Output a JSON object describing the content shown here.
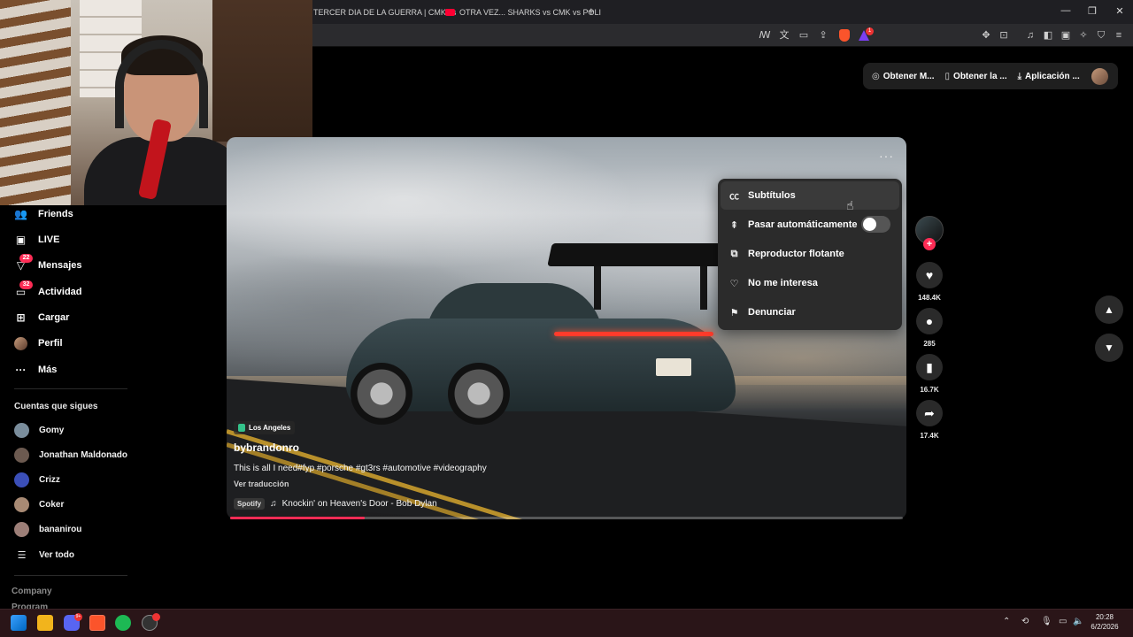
{
  "browser": {
    "tabs": [
      {
        "label": "TERCER DIA DE LA GUERRA | CMK vs"
      },
      {
        "label": "OTRA VEZ... SHARKS vs CMK vs POLI"
      }
    ],
    "new_tab": "+",
    "window_controls": {
      "minimize": "—",
      "restore": "❐",
      "close": "✕"
    },
    "brave_badge": "1"
  },
  "top_actions": {
    "get_coins": "Obtener M...",
    "get_app": "Obtener la ...",
    "app": "Aplicación ..."
  },
  "sidebar": {
    "items": [
      {
        "label": "Friends",
        "icon": "friends-icon",
        "glyph": "👥"
      },
      {
        "label": "LIVE",
        "icon": "live-icon",
        "glyph": "▣"
      },
      {
        "label": "Mensajes",
        "icon": "messages-icon",
        "glyph": "▽",
        "badge": "22"
      },
      {
        "label": "Actividad",
        "icon": "activity-icon",
        "glyph": "▭",
        "badge": "32"
      },
      {
        "label": "Cargar",
        "icon": "upload-icon",
        "glyph": "⊞"
      },
      {
        "label": "Perfil",
        "icon": "profile-icon",
        "glyph": ""
      },
      {
        "label": "Más",
        "icon": "more-icon",
        "glyph": "···"
      }
    ],
    "following_title": "Cuentas que sigues",
    "following": [
      {
        "name": "Gomy",
        "color": "#7a8d9c"
      },
      {
        "name": "Jonathan Maldonado",
        "color": "#6c5a50"
      },
      {
        "name": "Crizz",
        "color": "#3b4fb8"
      },
      {
        "name": "Coker",
        "color": "#a88a74"
      },
      {
        "name": "bananirou",
        "color": "#9d7f78"
      }
    ],
    "see_all": "Ver todo",
    "footer": [
      "Company",
      "Program"
    ]
  },
  "video": {
    "location": "Los Angeles",
    "author": "bybrandonro",
    "description": "This is all I need#fyp #porsche #gt3rs #automotive #videography",
    "translate": "Ver traducción",
    "music_source": "Spotify",
    "music": "Knockin' on Heaven's Door - Bob Dylan",
    "progress": 0.2,
    "more": "···"
  },
  "menu": {
    "items": [
      {
        "label": "Subtítulos",
        "icon": "subtitles-icon",
        "glyph": "㏄"
      },
      {
        "label": "Pasar automáticamente",
        "icon": "autoscroll-icon",
        "glyph": "⇞"
      },
      {
        "label": "Reproductor flotante",
        "icon": "floating-player-icon",
        "glyph": "⧉"
      },
      {
        "label": "No me interesa",
        "icon": "not-interested-icon",
        "glyph": "♡"
      },
      {
        "label": "Denunciar",
        "icon": "report-flag-icon",
        "glyph": "⚑"
      }
    ],
    "autoscroll_on": false
  },
  "actions": {
    "likes": "148.4K",
    "comments": "285",
    "saves": "16.7K",
    "shares": "17.4K",
    "follow_plus": "+"
  },
  "clock": {
    "time": "20:28",
    "date": "6/2/2026"
  },
  "taskbar": {
    "discord_badge": "9+"
  },
  "colors": {
    "accent": "#fe2c55",
    "menu_bg": "#2b2b2b",
    "taskbar": "#2a1518"
  }
}
